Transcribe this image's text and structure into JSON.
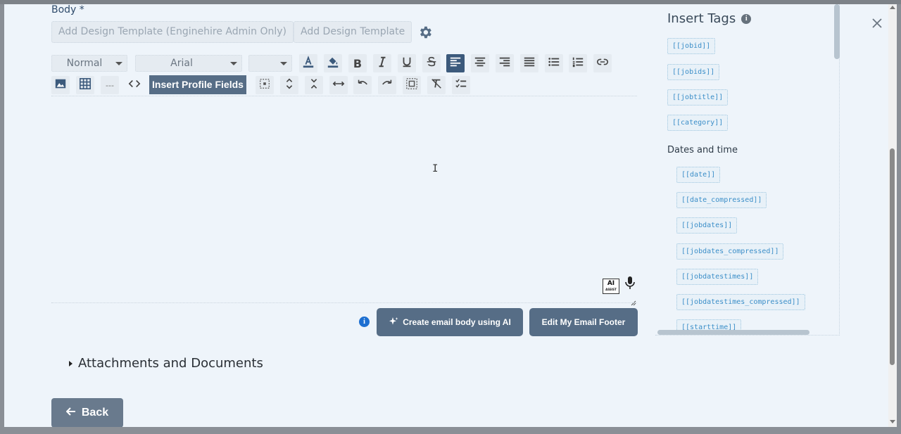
{
  "body": {
    "label": "Body *",
    "template_button_admin": "Add Design Template (Enginehire Admin Only)",
    "template_button": "Add Design Template"
  },
  "toolbar": {
    "paragraph_style": "Normal",
    "font_family": "Arial",
    "font_size": "",
    "bold_label": "B",
    "divider_label": "---",
    "insert_profile_fields": "Insert Profile Fields"
  },
  "editor": {
    "content": "",
    "ai_badge": "AI",
    "ai_badge_sub": "ASSIST"
  },
  "actions": {
    "info_icon_label": "i",
    "create_ai": "Create email body using AI",
    "edit_footer": "Edit My Email Footer"
  },
  "attachments": {
    "label": "Attachments and Documents"
  },
  "back": {
    "label": "Back"
  },
  "tags_panel": {
    "title": "Insert Tags",
    "info_icon_label": "i",
    "tags": [
      "[[jobid]]",
      "[[jobids]]",
      "[[jobtitle]]",
      "[[category]]"
    ],
    "dates_heading": "Dates and time",
    "date_tags": [
      "[[date]]",
      "[[date_compressed]]",
      "[[jobdates]]",
      "[[jobdates_compressed]]",
      "[[jobdatestimes]]",
      "[[jobdatestimes_compressed]]",
      "[[starttime]]"
    ]
  },
  "colors": {
    "primary_button": "#566d86",
    "tag_text": "#3b8ec8",
    "active_toolbar": "#3c5a7c",
    "info_blue": "#1d6fd1"
  }
}
